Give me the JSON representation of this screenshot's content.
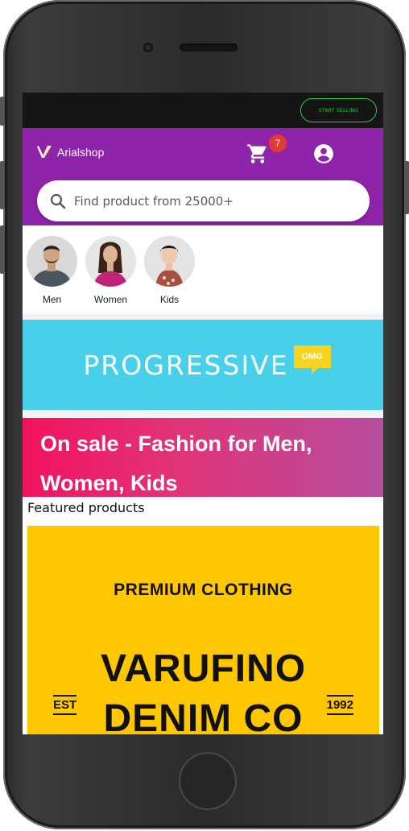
{
  "top_bar": {
    "start_selling_label": "START SELLING"
  },
  "header": {
    "logo_text": "Arialshop",
    "cart_count": "7",
    "search_placeholder": "Find product from 25000+"
  },
  "categories": [
    {
      "label": "Men"
    },
    {
      "label": "Women"
    },
    {
      "label": "Kids"
    }
  ],
  "banner": {
    "text": "PROGRESSIVE",
    "tag": "OMG"
  },
  "sale": {
    "line1": "On sale - Fashion for Men,",
    "line2": "Women, Kids"
  },
  "featured": {
    "title": "Featured products",
    "product": {
      "premium": "PREMIUM CLOTHING",
      "brand_line1": "VARUFINO",
      "brand_line2": "DENIM CO",
      "est": "EST",
      "year": "1992"
    }
  },
  "colors": {
    "header": "#8e24aa",
    "banner": "#48cfea",
    "sale_start": "#f2125f",
    "sale_end": "#b64d9e",
    "product_bg": "#ffc700",
    "badge": "#e53935"
  }
}
